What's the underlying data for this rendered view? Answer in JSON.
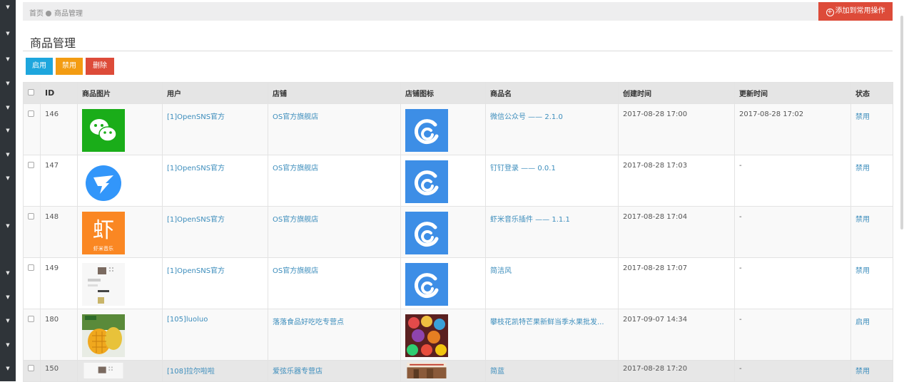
{
  "breadcrumb": {
    "home": "首页",
    "current": "商品管理"
  },
  "add_favorite_button": "添加到常用操作",
  "page_title": "商品管理",
  "actions": {
    "enable": "启用",
    "disable": "禁用",
    "delete": "删除"
  },
  "table": {
    "columns": [
      "ID",
      "商品图片",
      "用户",
      "店铺",
      "店铺图标",
      "商品名",
      "创建时间",
      "更新时间",
      "状态"
    ],
    "rows": [
      {
        "id": "146",
        "image": "wechat-logo",
        "user": "[1]OpenSNS官方",
        "shop": "OS官方旗舰店",
        "shop_icon": "opensns-logo",
        "name": "微信公众号 —— 2.1.0",
        "created": "2017-08-28 17:00",
        "updated": "2017-08-28 17:02",
        "status": "禁用"
      },
      {
        "id": "147",
        "image": "dingtalk-logo",
        "user": "[1]OpenSNS官方",
        "shop": "OS官方旗舰店",
        "shop_icon": "opensns-logo",
        "name": "钉钉登录 —— 0.0.1",
        "created": "2017-08-28 17:03",
        "updated": "-",
        "status": "禁用"
      },
      {
        "id": "148",
        "image": "xiami-logo",
        "image_text": "虾",
        "image_subtext": "虾米音乐",
        "user": "[1]OpenSNS官方",
        "shop": "OS官方旗舰店",
        "shop_icon": "opensns-logo",
        "name": "虾米音乐插件 —— 1.1.1",
        "created": "2017-08-28 17:04",
        "updated": "-",
        "status": "禁用"
      },
      {
        "id": "149",
        "image": "theme-screenshot",
        "user": "[1]OpenSNS官方",
        "shop": "OS官方旗舰店",
        "shop_icon": "opensns-logo",
        "name": "简洁风",
        "created": "2017-08-28 17:07",
        "updated": "-",
        "status": "禁用"
      },
      {
        "id": "180",
        "image": "mango-photo",
        "user": "[105]luoluo",
        "shop": "落落食品好吃吃专营点",
        "shop_icon": "candy-photo",
        "name": "攀枝花凯特芒果新鲜当季水果批发...",
        "created": "2017-09-07 14:34",
        "updated": "-",
        "status": "启用"
      },
      {
        "id": "150",
        "image": "theme-screenshot",
        "user": "[108]拉尔啦啦",
        "shop": "爱弦乐器专营店",
        "shop_icon": "instrument-photo",
        "name": "简蓝",
        "created": "2017-08-28 17:20",
        "updated": "-",
        "status": "禁用"
      }
    ]
  },
  "colors": {
    "sidebar": "#2f3439",
    "link": "#3c8dbc",
    "danger": "#dd4b39",
    "info": "#1ea6dd",
    "warning": "#f39c12",
    "opensns_blue": "#3d8ee6",
    "wechat_green": "#1aad19"
  }
}
